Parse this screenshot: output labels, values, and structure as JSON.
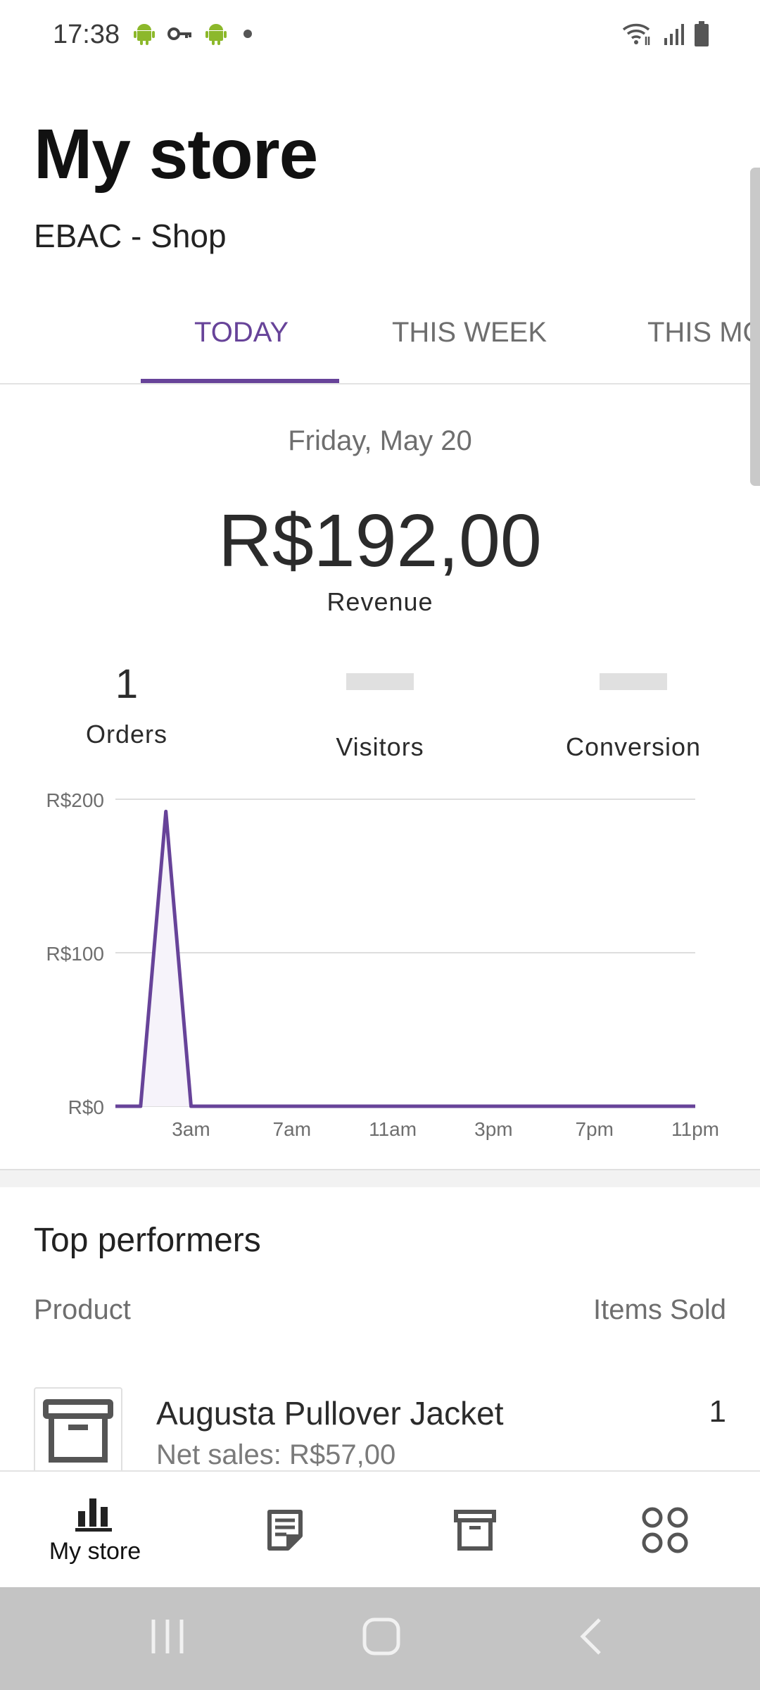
{
  "status_bar": {
    "time": "17:38",
    "left_icons": [
      "android-icon",
      "key-icon",
      "android-icon",
      "dot-icon"
    ],
    "right_icons": [
      "wifi-icon",
      "signal-icon",
      "battery-icon"
    ]
  },
  "header": {
    "title": "My store",
    "store_name": "EBAC - Shop"
  },
  "tabs": [
    {
      "label": "TODAY",
      "active": true
    },
    {
      "label": "THIS WEEK",
      "active": false
    },
    {
      "label": "THIS MO",
      "active": false
    }
  ],
  "stats": {
    "date": "Friday, May 20",
    "revenue_value": "R$192,00",
    "revenue_label": "Revenue",
    "orders_value": "1",
    "orders_label": "Orders",
    "visitors_label": "Visitors",
    "conversion_label": "Conversion"
  },
  "chart_data": {
    "type": "area",
    "x_tick_labels": [
      "3am",
      "7am",
      "11am",
      "3pm",
      "7pm",
      "11pm"
    ],
    "y_tick_labels": [
      "R$200",
      "R$100",
      "R$0"
    ],
    "ylim": [
      0,
      200
    ],
    "grid": true,
    "line_color": "#674399",
    "series": [
      {
        "x_hours": [
          0,
          1,
          2,
          3,
          4,
          5,
          6,
          7,
          8,
          9,
          10,
          11,
          12,
          13,
          14,
          15,
          16,
          17,
          18,
          19,
          20,
          21,
          22,
          23
        ],
        "values": [
          0,
          0,
          192,
          0,
          0,
          0,
          0,
          0,
          0,
          0,
          0,
          0,
          0,
          0,
          0,
          0,
          0,
          0,
          0,
          0,
          0,
          0,
          0,
          0
        ]
      }
    ]
  },
  "top_performers": {
    "title": "Top performers",
    "col_product": "Product",
    "col_items": "Items Sold",
    "rows": [
      {
        "name": "Augusta Pullover Jacket",
        "net_sales": "Net sales: R$57,00",
        "items_sold": "1",
        "icon": "archive-icon"
      }
    ]
  },
  "bottom_nav": [
    {
      "label": "My store",
      "icon": "bar-chart-icon",
      "active": true
    },
    {
      "label": "",
      "icon": "orders-icon",
      "active": false
    },
    {
      "label": "",
      "icon": "products-icon",
      "active": false
    },
    {
      "label": "",
      "icon": "more-apps-icon",
      "active": false
    }
  ],
  "colors": {
    "accent": "#674399",
    "system_nav_bg": "#c4c4c4"
  }
}
